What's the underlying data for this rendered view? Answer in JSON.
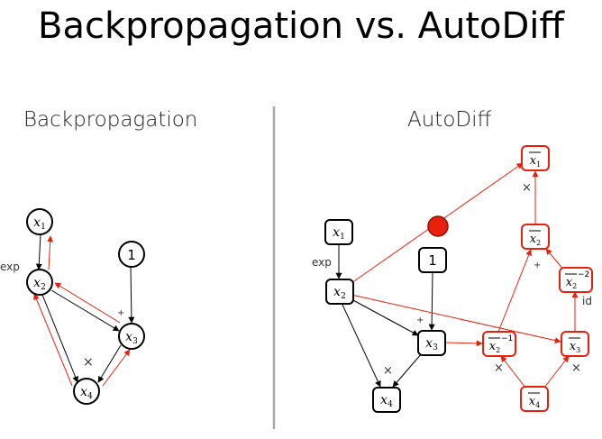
{
  "page_title": "Backpropagation vs.  AutoDiff",
  "colors": {
    "black": "#000000",
    "red": "#e8200c",
    "divider": "#aaaaaa"
  },
  "left_panel": {
    "heading": "Backpropagation",
    "nodes": {
      "x1": {
        "var": "x",
        "sub": "1"
      },
      "x2": {
        "var": "x",
        "sub": "2"
      },
      "x3": {
        "var": "x",
        "sub": "3"
      },
      "x4": {
        "var": "x",
        "sub": "4"
      },
      "one": "1"
    },
    "labels": {
      "exp": "exp",
      "plus": "+",
      "times": "×"
    }
  },
  "right_panel": {
    "heading": "AutoDiff",
    "nodes": {
      "x1": {
        "var": "x",
        "sub": "1"
      },
      "x2": {
        "var": "x",
        "sub": "2"
      },
      "x3": {
        "var": "x",
        "sub": "3"
      },
      "x4": {
        "var": "x",
        "sub": "4"
      },
      "one": "1",
      "bar_x1": {
        "var": "x",
        "sub": "1"
      },
      "bar_x2": {
        "var": "x",
        "sub": "2"
      },
      "bar_x2_sq": {
        "var": "x",
        "sub": "2",
        "sup": "−2"
      },
      "bar_x2_inv": {
        "var": "x",
        "sub": "2",
        "sup": "−1"
      },
      "bar_x3": {
        "var": "x",
        "sub": "3"
      },
      "bar_x4": {
        "var": "x",
        "sub": "4"
      }
    },
    "labels": {
      "exp": "exp",
      "plus_main": "+",
      "plus_adj": "+",
      "id": "id",
      "times_x4": "×",
      "times_x1bar": "×",
      "times_x2inv": "×",
      "times_x3bar": "×"
    }
  }
}
